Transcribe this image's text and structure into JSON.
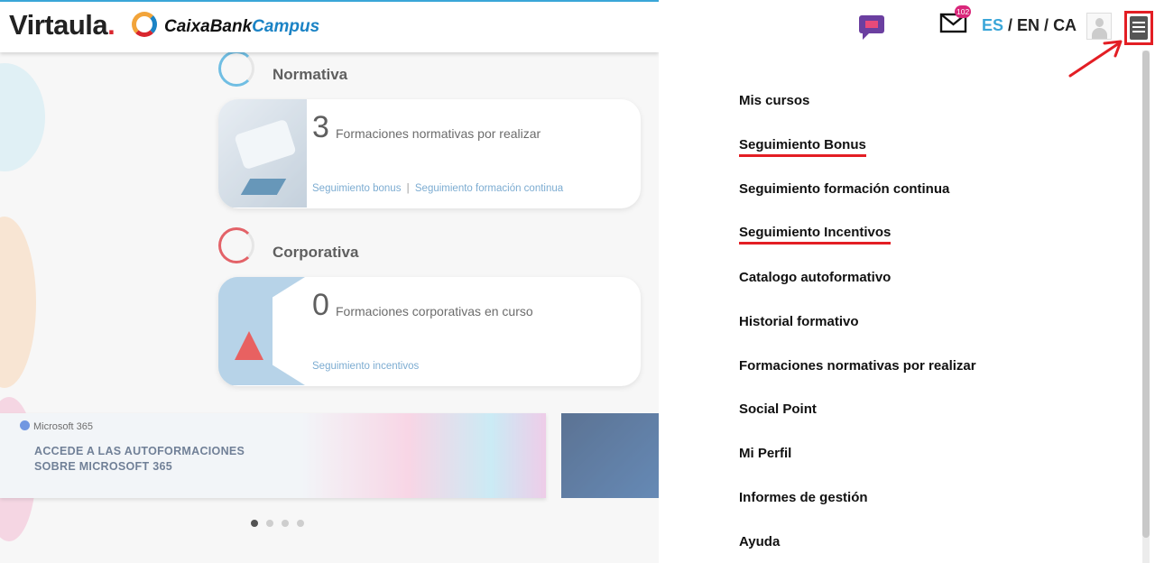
{
  "header": {
    "logo_text": "Virtaula",
    "logo_dot": ".",
    "logo_sub_a": "CaixaBank",
    "logo_sub_b": "Campus"
  },
  "sections": {
    "normativa": {
      "title": "Normativa",
      "count": "3",
      "description": "Formaciones normativas por realizar",
      "link_1": "Seguimiento bonus",
      "separator": "|",
      "link_2": "Seguimiento formación continua"
    },
    "corporativa": {
      "title": "Corporativa",
      "count": "0",
      "description": "Formaciones corporativas en curso",
      "link_1": "Seguimiento incentivos"
    }
  },
  "banner": {
    "brand": "Microsoft 365",
    "line1": "ACCEDE A LAS AUTOFORMACIONES",
    "line2": "SOBRE MICROSOFT 365",
    "slides_total": 4,
    "active_slide": 1
  },
  "toolbar": {
    "mail_badge": "102",
    "lang_es": "ES",
    "lang_sep1": " / ",
    "lang_en": "EN",
    "lang_sep2": " / ",
    "lang_ca": "CA"
  },
  "menu": {
    "items": [
      {
        "label": "Mis cursos",
        "marked": false
      },
      {
        "label": "Seguimiento Bonus",
        "marked": true
      },
      {
        "label": "Seguimiento formación continua",
        "marked": false
      },
      {
        "label": "Seguimiento Incentivos",
        "marked": true
      },
      {
        "label": "Catalogo autoformativo",
        "marked": false
      },
      {
        "label": "Historial formativo",
        "marked": false
      },
      {
        "label": "Formaciones normativas por realizar",
        "marked": false
      },
      {
        "label": "Social Point",
        "marked": false
      },
      {
        "label": "Mi Perfil",
        "marked": false
      },
      {
        "label": "Informes de gestión",
        "marked": false
      },
      {
        "label": "Ayuda",
        "marked": false
      }
    ]
  },
  "colors": {
    "accent_blue": "#3aa6d8",
    "annotation_red": "#e31e24",
    "chat_purple": "#6b3fa0"
  }
}
